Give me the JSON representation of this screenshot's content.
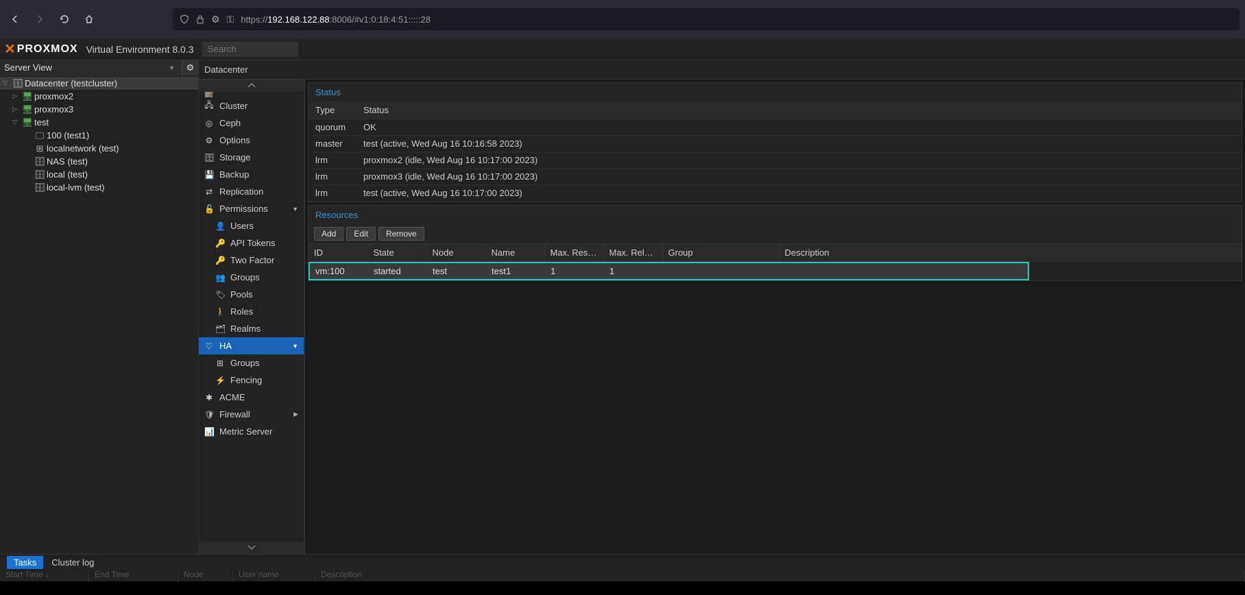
{
  "browser": {
    "url_prefix": "https://",
    "url_host": "192.168.122.88",
    "url_suffix": ":8006/#v1:0:18:4:51:::::28"
  },
  "header": {
    "product": "PROXMOX",
    "subtitle": "Virtual Environment 8.0.3",
    "search_placeholder": "Search"
  },
  "view_selector": "Server View",
  "tree": {
    "datacenter": "Datacenter (testcluster)",
    "nodes": [
      {
        "label": "proxmox2"
      },
      {
        "label": "proxmox3"
      },
      {
        "label": "test"
      }
    ],
    "test_children": [
      {
        "label": "100 (test1)",
        "icon": "monitor"
      },
      {
        "label": "localnetwork (test)",
        "icon": "net"
      },
      {
        "label": "NAS (test)",
        "icon": "db"
      },
      {
        "label": "local (test)",
        "icon": "db"
      },
      {
        "label": "local-lvm (test)",
        "icon": "db"
      }
    ]
  },
  "breadcrumb": "Datacenter",
  "menu": [
    {
      "label": "Notes",
      "icon": "📝",
      "truncated": true
    },
    {
      "label": "Cluster",
      "icon": "🖧"
    },
    {
      "label": "Ceph",
      "icon": "◎"
    },
    {
      "label": "Options",
      "icon": "⚙"
    },
    {
      "label": "Storage",
      "icon": "🗄"
    },
    {
      "label": "Backup",
      "icon": "💾"
    },
    {
      "label": "Replication",
      "icon": "⇄"
    },
    {
      "label": "Permissions",
      "icon": "🔓",
      "expandable": true
    },
    {
      "label": "Users",
      "icon": "👤",
      "sub": true
    },
    {
      "label": "API Tokens",
      "icon": "🔑",
      "sub": true
    },
    {
      "label": "Two Factor",
      "icon": "🔑",
      "sub": true
    },
    {
      "label": "Groups",
      "icon": "👥",
      "sub": true
    },
    {
      "label": "Pools",
      "icon": "🏷",
      "sub": true
    },
    {
      "label": "Roles",
      "icon": "🚶",
      "sub": true
    },
    {
      "label": "Realms",
      "icon": "🗂",
      "sub": true
    },
    {
      "label": "HA",
      "icon": "♡",
      "active": true,
      "expandable": true
    },
    {
      "label": "Groups",
      "icon": "⊞",
      "sub": true
    },
    {
      "label": "Fencing",
      "icon": "⚡",
      "sub": true
    },
    {
      "label": "ACME",
      "icon": "✱"
    },
    {
      "label": "Firewall",
      "icon": "🛡",
      "expandable_right": true
    },
    {
      "label": "Metric Server",
      "icon": "📊"
    }
  ],
  "status": {
    "title": "Status",
    "headers": {
      "type": "Type",
      "status": "Status"
    },
    "rows": [
      {
        "type": "quorum",
        "status": "OK"
      },
      {
        "type": "master",
        "status": "test (active, Wed Aug 16 10:16:58 2023)"
      },
      {
        "type": "lrm",
        "status": "proxmox2 (idle, Wed Aug 16 10:17:00 2023)"
      },
      {
        "type": "lrm",
        "status": "proxmox3 (idle, Wed Aug 16 10:17:00 2023)"
      },
      {
        "type": "lrm",
        "status": "test (active, Wed Aug 16 10:17:00 2023)"
      }
    ]
  },
  "resources": {
    "title": "Resources",
    "buttons": {
      "add": "Add",
      "edit": "Edit",
      "remove": "Remove"
    },
    "headers": {
      "id": "ID",
      "state": "State",
      "node": "Node",
      "name": "Name",
      "max_restart": "Max. Restart",
      "max_reloc": "Max. Reloc…",
      "group": "Group",
      "description": "Description"
    },
    "rows": [
      {
        "id": "vm:100",
        "state": "started",
        "node": "test",
        "name": "test1",
        "max_restart": "1",
        "max_reloc": "1",
        "group": "",
        "description": ""
      }
    ]
  },
  "bottom": {
    "tabs": {
      "tasks": "Tasks",
      "cluster_log": "Cluster log"
    },
    "headers": {
      "start": "Start Time ↓",
      "end": "End Time",
      "node": "Node",
      "user": "User name",
      "desc": "Description"
    }
  }
}
